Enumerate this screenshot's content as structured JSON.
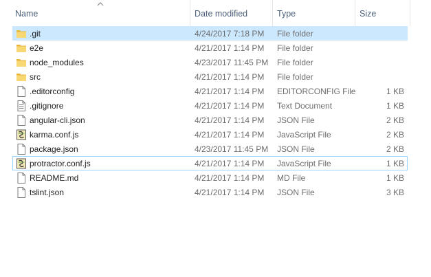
{
  "columns": {
    "name": "Name",
    "date_modified": "Date modified",
    "type": "Type",
    "size": "Size"
  },
  "sort": {
    "column": "name",
    "direction": "ascending"
  },
  "colors": {
    "selection_bg": "#cce8ff",
    "focus_border": "#99d1ff",
    "folder_yellow": "#f8d775",
    "header_text": "#4c607a"
  },
  "files": [
    {
      "name": ".git",
      "date": "4/24/2017 7:18 PM",
      "type": "File folder",
      "size": "",
      "icon": "folder-icon",
      "selected": true
    },
    {
      "name": "e2e",
      "date": "4/21/2017 1:14 PM",
      "type": "File folder",
      "size": "",
      "icon": "folder-icon"
    },
    {
      "name": "node_modules",
      "date": "4/23/2017 11:45 PM",
      "type": "File folder",
      "size": "",
      "icon": "folder-icon"
    },
    {
      "name": "src",
      "date": "4/21/2017 1:14 PM",
      "type": "File folder",
      "size": "",
      "icon": "folder-icon"
    },
    {
      "name": ".editorconfig",
      "date": "4/21/2017 1:14 PM",
      "type": "EDITORCONFIG File",
      "size": "1 KB",
      "icon": "file-icon"
    },
    {
      "name": ".gitignore",
      "date": "4/21/2017 1:14 PM",
      "type": "Text Document",
      "size": "1 KB",
      "icon": "text-document-icon"
    },
    {
      "name": "angular-cli.json",
      "date": "4/21/2017 1:14 PM",
      "type": "JSON File",
      "size": "2 KB",
      "icon": "file-icon"
    },
    {
      "name": "karma.conf.js",
      "date": "4/21/2017 1:14 PM",
      "type": "JavaScript File",
      "size": "2 KB",
      "icon": "javascript-file-icon"
    },
    {
      "name": "package.json",
      "date": "4/23/2017 11:45 PM",
      "type": "JSON File",
      "size": "2 KB",
      "icon": "file-icon"
    },
    {
      "name": "protractor.conf.js",
      "date": "4/21/2017 1:14 PM",
      "type": "JavaScript File",
      "size": "1 KB",
      "icon": "javascript-file-icon",
      "focused": true
    },
    {
      "name": "README.md",
      "date": "4/21/2017 1:14 PM",
      "type": "MD File",
      "size": "1 KB",
      "icon": "file-icon"
    },
    {
      "name": "tslint.json",
      "date": "4/21/2017 1:14 PM",
      "type": "JSON File",
      "size": "3 KB",
      "icon": "file-icon"
    }
  ]
}
